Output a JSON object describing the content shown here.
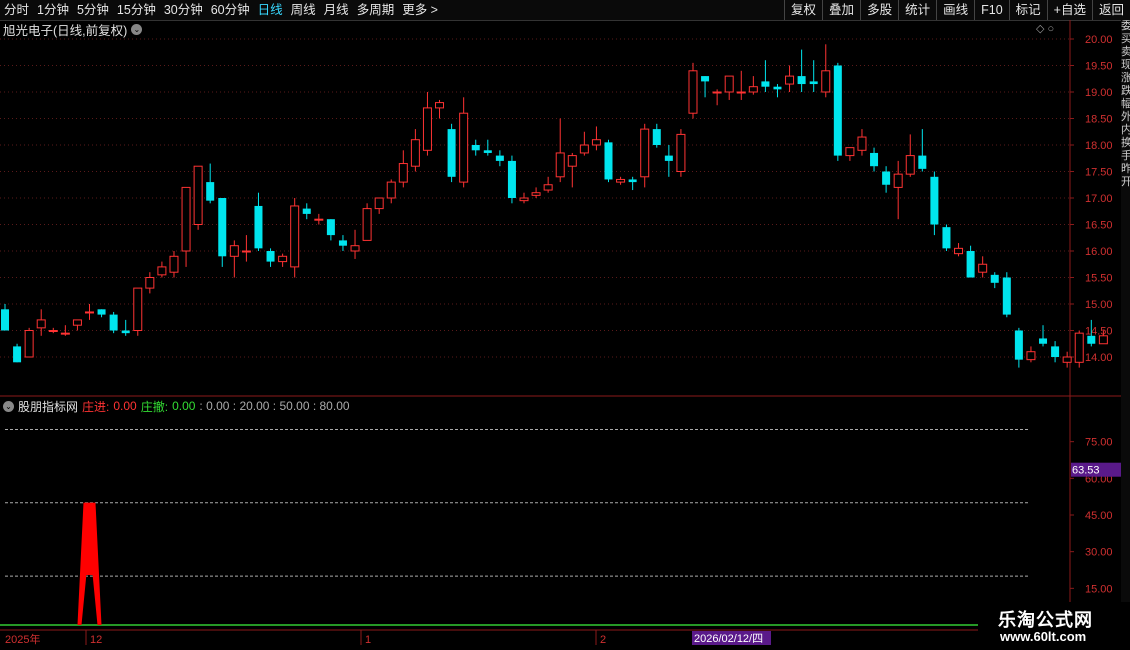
{
  "toolbar": {
    "periods": [
      "分时",
      "1分钟",
      "5分钟",
      "15分钟",
      "30分钟",
      "60分钟",
      "日线",
      "周线",
      "月线",
      "多周期",
      "更多 >"
    ],
    "active_period": "日线",
    "actions": [
      "复权",
      "叠加",
      "多股",
      "统计",
      "画线",
      "F10",
      "标记",
      "+自选",
      "返回"
    ]
  },
  "stock": {
    "title": "旭光电子(日线,前复权)",
    "dropdown_icon": "chevron-down-icon"
  },
  "indicator": {
    "name": "股朋指标网",
    "zhuangjin_label": "庄进:",
    "zhuangjin_value": "0.00",
    "zhuangsan_label": "庄撤:",
    "zhuangsan_value": "0.00",
    "params": ": 0.00 : 20.00 : 50.00 : 80.00",
    "signal_label": "庄进",
    "current_value": "63.53"
  },
  "price_axis": [
    "20.00",
    "19.50",
    "19.00",
    "18.50",
    "18.00",
    "17.50",
    "17.00",
    "16.50",
    "16.00",
    "15.50",
    "15.00",
    "14.50",
    "14.00"
  ],
  "indicator_axis": [
    "75.00",
    "60.00",
    "45.00",
    "30.00",
    "15.00"
  ],
  "time_axis": {
    "year_label": "2025年",
    "month_labels": [
      "12",
      "1",
      "2"
    ],
    "cursor_date": "2026/02/12/四"
  },
  "side_chars": "委买卖现涨跌幅外内换手昨开",
  "watermark": {
    "name": "乐淘公式网",
    "url": "www.60lt.com"
  },
  "colors": {
    "up": "#ff3333",
    "down": "#00e5ee",
    "bg": "#000000",
    "signal": "#ff0000",
    "zero_line": "#33cc33"
  },
  "chart_data": {
    "type": "candlestick",
    "price_ylim": [
      13.5,
      20.1
    ],
    "candles": [
      [
        14.9,
        14.5,
        15.0,
        14.5
      ],
      [
        14.2,
        13.9,
        14.25,
        13.9
      ],
      [
        14.0,
        14.5,
        14.55,
        14.0
      ],
      [
        14.55,
        14.7,
        14.9,
        14.4
      ],
      [
        14.5,
        14.5,
        14.55,
        14.45
      ],
      [
        14.45,
        14.45,
        14.6,
        14.4
      ],
      [
        14.6,
        14.7,
        14.7,
        14.5
      ],
      [
        14.85,
        14.85,
        15.0,
        14.7
      ],
      [
        14.9,
        14.8,
        14.9,
        14.75
      ],
      [
        14.8,
        14.5,
        14.85,
        14.45
      ],
      [
        14.5,
        14.45,
        14.7,
        14.4
      ],
      [
        14.5,
        15.3,
        15.3,
        14.4
      ],
      [
        15.3,
        15.5,
        15.6,
        15.2
      ],
      [
        15.55,
        15.7,
        15.8,
        15.5
      ],
      [
        15.6,
        15.9,
        16.0,
        15.5
      ],
      [
        16.0,
        17.2,
        17.2,
        15.7
      ],
      [
        16.5,
        17.6,
        17.6,
        16.4
      ],
      [
        17.3,
        16.95,
        17.65,
        16.9
      ],
      [
        17.0,
        15.9,
        17.0,
        15.7
      ],
      [
        15.9,
        16.1,
        16.2,
        15.5
      ],
      [
        16.0,
        16.0,
        16.3,
        15.8
      ],
      [
        16.85,
        16.05,
        17.1,
        16.0
      ],
      [
        16.0,
        15.8,
        16.05,
        15.7
      ],
      [
        15.8,
        15.9,
        15.95,
        15.7
      ],
      [
        15.7,
        16.85,
        17.0,
        15.5
      ],
      [
        16.8,
        16.7,
        16.9,
        16.6
      ],
      [
        16.6,
        16.6,
        16.7,
        16.5
      ],
      [
        16.6,
        16.3,
        16.6,
        16.2
      ],
      [
        16.2,
        16.1,
        16.3,
        16.0
      ],
      [
        16.0,
        16.1,
        16.4,
        15.85
      ],
      [
        16.2,
        16.8,
        16.9,
        16.2
      ],
      [
        16.8,
        17.0,
        17.0,
        16.7
      ],
      [
        17.0,
        17.3,
        17.35,
        16.9
      ],
      [
        17.3,
        17.65,
        17.9,
        17.2
      ],
      [
        17.6,
        18.1,
        18.3,
        17.5
      ],
      [
        17.9,
        18.7,
        19.0,
        17.8
      ],
      [
        18.7,
        18.8,
        18.85,
        18.5
      ],
      [
        18.3,
        17.4,
        18.4,
        17.3
      ],
      [
        17.3,
        18.6,
        18.9,
        17.2
      ],
      [
        18.0,
        17.9,
        18.1,
        17.8
      ],
      [
        17.9,
        17.85,
        18.1,
        17.8
      ],
      [
        17.8,
        17.7,
        17.9,
        17.6
      ],
      [
        17.7,
        17.0,
        17.8,
        16.9
      ],
      [
        16.95,
        17.0,
        17.1,
        16.9
      ],
      [
        17.05,
        17.1,
        17.2,
        17.0
      ],
      [
        17.15,
        17.25,
        17.4,
        17.1
      ],
      [
        17.4,
        17.85,
        18.5,
        17.3
      ],
      [
        17.6,
        17.8,
        17.85,
        17.2
      ],
      [
        17.85,
        18.0,
        18.25,
        17.8
      ],
      [
        18.0,
        18.1,
        18.35,
        17.9
      ],
      [
        18.05,
        17.35,
        18.1,
        17.3
      ],
      [
        17.3,
        17.35,
        17.4,
        17.25
      ],
      [
        17.35,
        17.3,
        17.4,
        17.15
      ],
      [
        17.4,
        18.3,
        18.4,
        17.2
      ],
      [
        18.3,
        18.0,
        18.4,
        17.95
      ],
      [
        17.8,
        17.7,
        18.0,
        17.4
      ],
      [
        17.5,
        18.2,
        18.3,
        17.4
      ],
      [
        18.6,
        19.4,
        19.55,
        18.5
      ],
      [
        19.3,
        19.2,
        19.3,
        18.9
      ],
      [
        19.0,
        19.0,
        19.05,
        18.75
      ],
      [
        19.0,
        19.3,
        19.3,
        18.85
      ],
      [
        19.0,
        19.0,
        19.4,
        18.85
      ],
      [
        19.0,
        19.1,
        19.3,
        18.95
      ],
      [
        19.2,
        19.1,
        19.6,
        19.0
      ],
      [
        19.1,
        19.05,
        19.15,
        18.9
      ],
      [
        19.15,
        19.3,
        19.5,
        19.0
      ],
      [
        19.3,
        19.15,
        19.8,
        19.0
      ],
      [
        19.2,
        19.15,
        19.6,
        19.0
      ],
      [
        19.0,
        19.4,
        19.9,
        18.9
      ],
      [
        19.5,
        17.8,
        19.55,
        17.7
      ],
      [
        17.8,
        17.95,
        17.95,
        17.7
      ],
      [
        17.9,
        18.15,
        18.3,
        17.8
      ],
      [
        17.85,
        17.6,
        17.95,
        17.5
      ],
      [
        17.5,
        17.25,
        17.6,
        17.1
      ],
      [
        17.2,
        17.45,
        17.7,
        16.6
      ],
      [
        17.45,
        17.8,
        18.2,
        17.4
      ],
      [
        17.8,
        17.55,
        18.3,
        17.5
      ],
      [
        17.4,
        16.5,
        17.5,
        16.3
      ],
      [
        16.45,
        16.05,
        16.5,
        16.0
      ],
      [
        15.95,
        16.05,
        16.15,
        15.9
      ],
      [
        16.0,
        15.5,
        16.1,
        15.5
      ],
      [
        15.6,
        15.75,
        15.9,
        15.5
      ],
      [
        15.55,
        15.4,
        15.6,
        15.3
      ],
      [
        15.5,
        14.8,
        15.6,
        14.75
      ],
      [
        14.5,
        13.95,
        14.55,
        13.8
      ],
      [
        13.95,
        14.1,
        14.2,
        13.9
      ],
      [
        14.35,
        14.25,
        14.6,
        14.2
      ],
      [
        14.2,
        14.0,
        14.3,
        13.9
      ],
      [
        13.9,
        14.0,
        14.1,
        13.8
      ],
      [
        13.9,
        14.45,
        14.5,
        13.8
      ],
      [
        14.4,
        14.25,
        14.7,
        14.2
      ],
      [
        14.25,
        14.4,
        14.5,
        14.25
      ]
    ],
    "indicator_series": {
      "name": "庄进",
      "signal_bar_index": 7,
      "signal_value": 50,
      "dashed_levels": [
        80,
        50,
        20
      ],
      "ylim": [
        0,
        90
      ]
    }
  }
}
